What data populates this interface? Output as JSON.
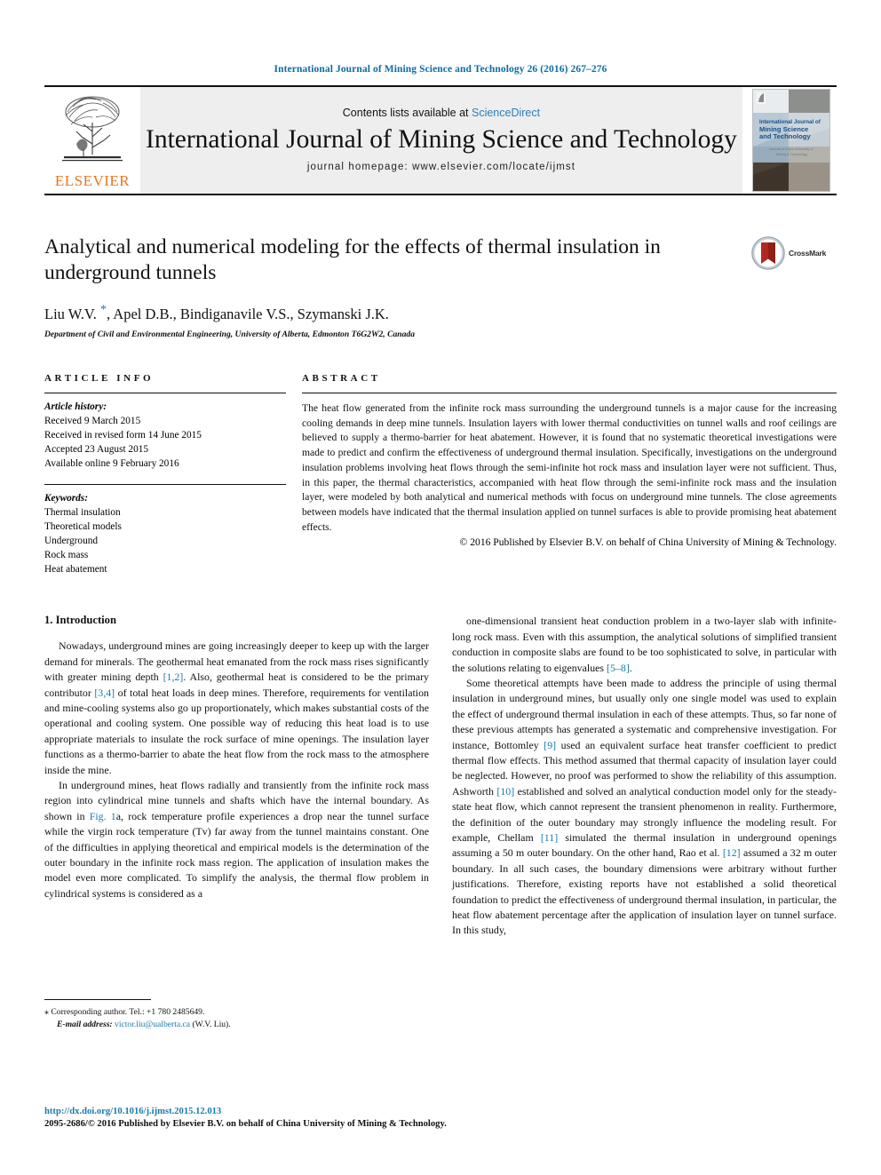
{
  "running_head": "International Journal of Mining Science and Technology 26 (2016) 267–276",
  "masthead": {
    "publisher_name": "ELSEVIER",
    "contents_prefix": "Contents lists available at ",
    "contents_link": "ScienceDirect",
    "journal_title": "International Journal of Mining Science and Technology",
    "homepage_line": "journal homepage: www.elsevier.com/locate/ijmst",
    "cover_title_lines": [
      "International Journal of",
      "Mining Science",
      "and Technology"
    ]
  },
  "article": {
    "title": "Analytical and numerical modeling for the effects of thermal insulation in underground tunnels",
    "crossmark_label": "CrossMark",
    "authors": "Liu W.V. *, Apel D.B., Bindiganavile V.S., Szymanski J.K.",
    "affiliation": "Department of Civil and Environmental Engineering, University of Alberta, Edmonton T6G2W2, Canada"
  },
  "info": {
    "heading": "ARTICLE INFO",
    "history_label": "Article history:",
    "history": [
      "Received 9 March 2015",
      "Received in revised form 14 June 2015",
      "Accepted 23 August 2015",
      "Available online 9 February 2016"
    ],
    "keywords_label": "Keywords:",
    "keywords": [
      "Thermal insulation",
      "Theoretical models",
      "Underground",
      "Rock mass",
      "Heat abatement"
    ]
  },
  "abstract": {
    "heading": "ABSTRACT",
    "text": "The heat flow generated from the infinite rock mass surrounding the underground tunnels is a major cause for the increasing cooling demands in deep mine tunnels. Insulation layers with lower thermal conductivities on tunnel walls and roof ceilings are believed to supply a thermo-barrier for heat abatement. However, it is found that no systematic theoretical investigations were made to predict and confirm the effectiveness of underground thermal insulation. Specifically, investigations on the underground insulation problems involving heat flows through the semi-infinite hot rock mass and insulation layer were not sufficient. Thus, in this paper, the thermal characteristics, accompanied with heat flow through the semi-infinite rock mass and the insulation layer, were modeled by both analytical and numerical methods with focus on underground mine tunnels. The close agreements between models have indicated that the thermal insulation applied on tunnel surfaces is able to provide promising heat abatement effects.",
    "copyright": "© 2016 Published by Elsevier B.V. on behalf of China University of Mining & Technology."
  },
  "body": {
    "section_title": "1. Introduction",
    "left_paragraphs": [
      {
        "parts": [
          {
            "t": "Nowadays, underground mines are going increasingly deeper to keep up with the larger demand for minerals. The geothermal heat emanated from the rock mass rises significantly with greater mining depth ",
            "ref": false
          },
          {
            "t": "[1,2]",
            "ref": true
          },
          {
            "t": ". Also, geothermal heat is considered to be the primary contributor ",
            "ref": false
          },
          {
            "t": "[3,4]",
            "ref": true
          },
          {
            "t": " of total heat loads in deep mines. Therefore, requirements for ventilation and mine-cooling systems also go up proportionately, which makes substantial costs of the operational and cooling system. One possible way of reducing this heat load is to use appropriate materials to insulate the rock surface of mine openings. The insulation layer functions as a thermo-barrier to abate the heat flow from the rock mass to the atmosphere inside the mine.",
            "ref": false
          }
        ]
      },
      {
        "parts": [
          {
            "t": "In underground mines, heat flows radially and transiently from the infinite rock mass region into cylindrical mine tunnels and shafts which have the internal boundary. As shown in ",
            "ref": false
          },
          {
            "t": "Fig. 1",
            "ref": true
          },
          {
            "t": "a, rock temperature profile experiences a drop near the tunnel surface while the virgin rock temperature (Tv) far away from the tunnel maintains constant. One of the difficulties in applying theoretical and empirical models is the determination of the outer boundary in the infinite rock mass region. The application of insulation makes the model even more complicated. To simplify the analysis, the thermal flow problem in cylindrical systems is considered as a",
            "ref": false
          }
        ]
      }
    ],
    "right_paragraphs": [
      {
        "parts": [
          {
            "t": "one-dimensional transient heat conduction problem in a two-layer slab with infinite-long rock mass. Even with this assumption, the analytical solutions of simplified transient conduction in composite slabs are found to be too sophisticated to solve, in particular with the solutions relating to eigenvalues ",
            "ref": false
          },
          {
            "t": "[5–8]",
            "ref": true
          },
          {
            "t": ".",
            "ref": false
          }
        ]
      },
      {
        "parts": [
          {
            "t": "Some theoretical attempts have been made to address the principle of using thermal insulation in underground mines, but usually only one single model was used to explain the effect of underground thermal insulation in each of these attempts. Thus, so far none of these previous attempts has generated a systematic and comprehensive investigation. For instance, Bottomley ",
            "ref": false
          },
          {
            "t": "[9]",
            "ref": true
          },
          {
            "t": " used an equivalent surface heat transfer coefficient to predict thermal flow effects. This method assumed that thermal capacity of insulation layer could be neglected. However, no proof was performed to show the reliability of this assumption. Ashworth ",
            "ref": false
          },
          {
            "t": "[10]",
            "ref": true
          },
          {
            "t": " established and solved an analytical conduction model only for the steady-state heat flow, which cannot represent the transient phenomenon in reality. Furthermore, the definition of the outer boundary may strongly influence the modeling result. For example, Chellam ",
            "ref": false
          },
          {
            "t": "[11]",
            "ref": true
          },
          {
            "t": " simulated the thermal insulation in underground openings assuming a 50 m outer boundary. On the other hand, Rao et al. ",
            "ref": false
          },
          {
            "t": "[12]",
            "ref": true
          },
          {
            "t": " assumed a 32 m outer boundary. In all such cases, the boundary dimensions were arbitrary without further justifications. Therefore, existing reports have not established a solid theoretical foundation to predict the effectiveness of underground thermal insulation, in particular, the heat flow abatement percentage after the application of insulation layer on tunnel surface. In this study,",
            "ref": false
          }
        ]
      }
    ]
  },
  "footnote": {
    "corresponding": "Corresponding author. Tel.: +1 780 2485649.",
    "email_label": "E-mail address:",
    "email": "victor.liu@ualberta.ca",
    "email_suffix": "(W.V. Liu)."
  },
  "footer": {
    "doi": "http://dx.doi.org/10.1016/j.ijmst.2015.12.013",
    "issn_line": "2095-2686/© 2016 Published by Elsevier B.V. on behalf of China University of Mining & Technology."
  },
  "colors": {
    "link": "#1a79ad",
    "running_head": "#0b6ca8",
    "elsevier_orange": "#E87722",
    "masthead_bg": "#eeeeee"
  }
}
